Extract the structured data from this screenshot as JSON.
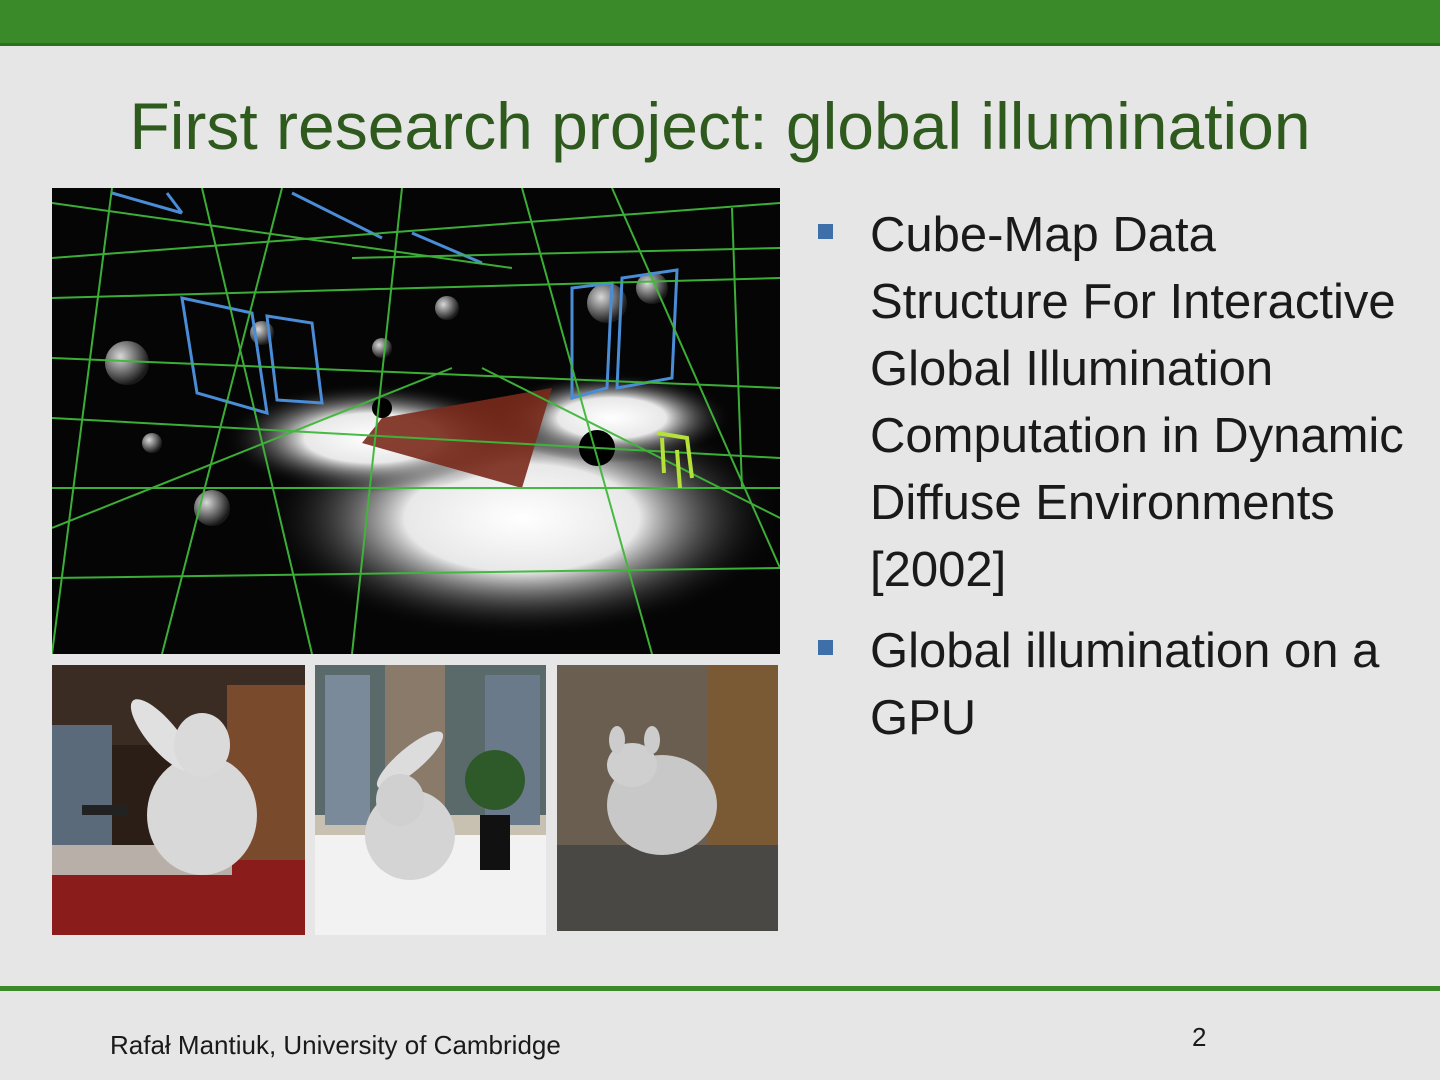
{
  "slide": {
    "title": "First research project: global illumination",
    "bullets": [
      {
        "text": "Cube-Map Data Structure For Interactive Global Illumination Computation in Dynamic Diffuse Environments [2002]"
      },
      {
        "text": "Global illumination on a GPU"
      }
    ],
    "footer": "Rafał Mantiuk, University of Cambridge",
    "page_number": "2"
  },
  "colors": {
    "accent_bar": "#3b8a2a",
    "title_text": "#2f5a1e",
    "bullet_marker": "#3e6fa8"
  }
}
